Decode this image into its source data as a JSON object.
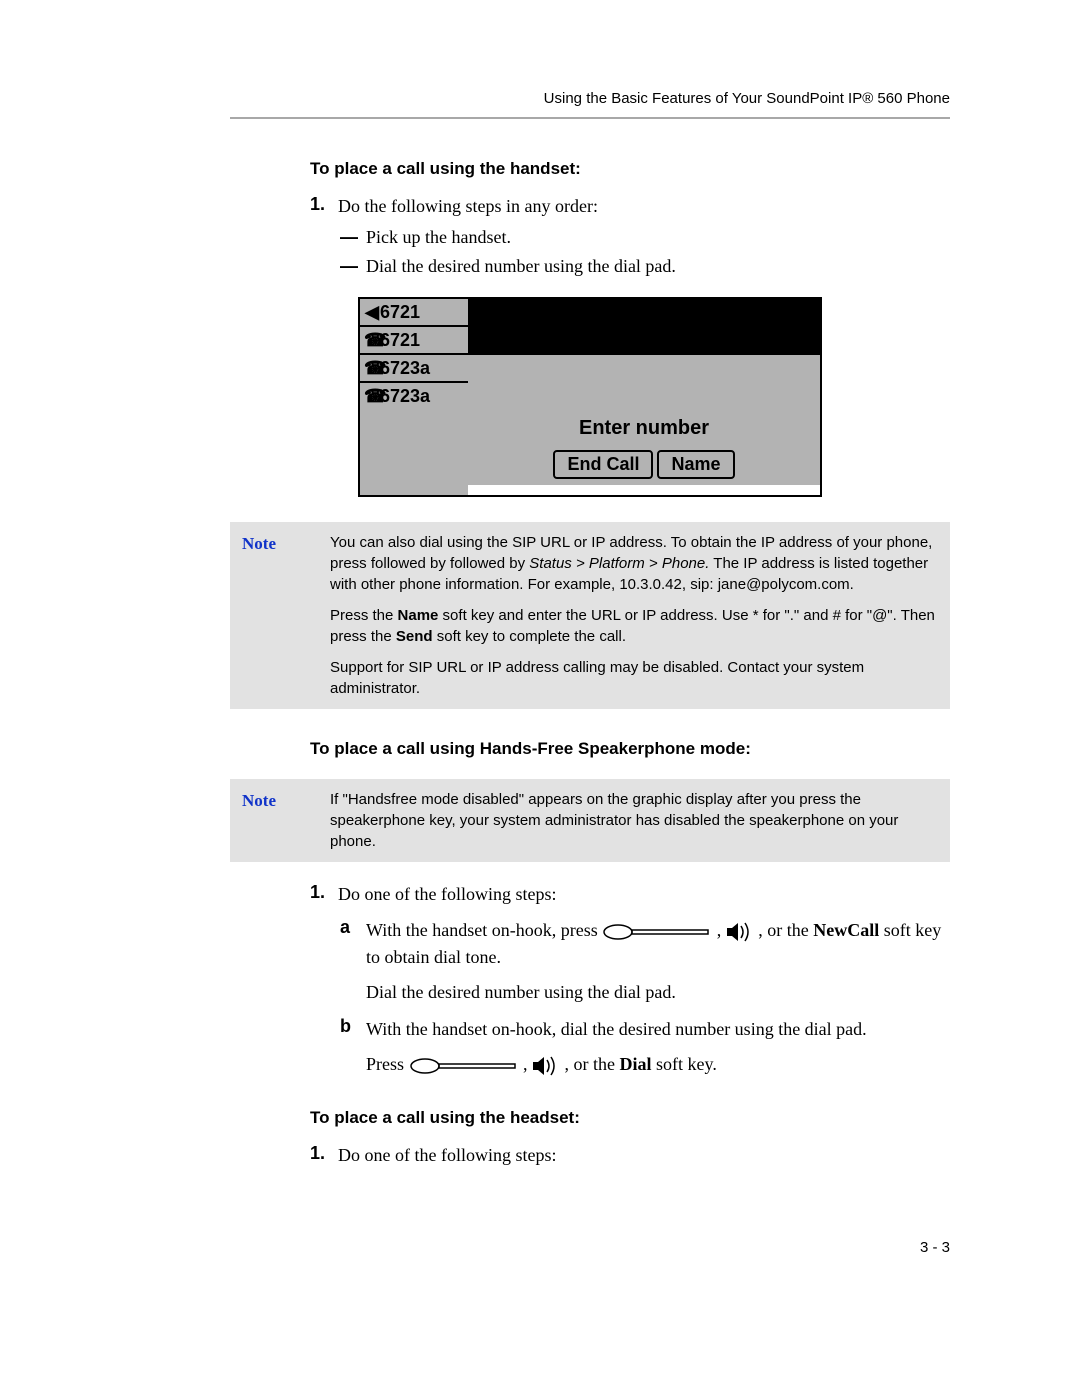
{
  "header": {
    "running_head": "Using the Basic Features of Your SoundPoint IP® 560 Phone"
  },
  "page_number": "3 - 3",
  "section1": {
    "heading": "To place a call using the handset:",
    "step1_num": "1.",
    "step1_text": "Do the following steps in any order:",
    "dash": "—",
    "bullet_a": "Pick up the handset.",
    "bullet_b": "Dial the desired number using the dial pad."
  },
  "lcd": {
    "line1": "6721",
    "line2": "6721",
    "line3": "6723a",
    "line4": "6723a",
    "prompt": "Enter number",
    "softkey1": "End Call",
    "softkey2": "Name"
  },
  "note1": {
    "label": "Note",
    "p1a": "You can also dial using the SIP URL or IP address. To obtain the IP address of your phone, press followed by followed by ",
    "p1b": "Status > Platform > Phone.",
    "p1c": " The IP address is listed together with other phone information. For example, 10.3.0.42, sip: jane@polycom.com.",
    "p2a": "Press the ",
    "p2b": "Name",
    "p2c": " soft key and enter the URL or IP address. Use * for \".\" and # for \"@\". Then press the ",
    "p2d": "Send",
    "p2e": " soft key to complete the call.",
    "p3": "Support for SIP URL or IP address calling may be disabled. Contact your system administrator."
  },
  "section2": {
    "heading": "To place a call using Hands-Free Speakerphone mode:"
  },
  "note2": {
    "label": "Note",
    "p1": "If \"Handsfree mode disabled\" appears on the graphic display after you press the speakerphone key, your system administrator has disabled the speakerphone on your phone."
  },
  "steps2": {
    "step1_num": "1.",
    "step1_text": "Do one of the following steps:",
    "a_label": "a",
    "a_pre": "With the handset on-hook, press ",
    "a_post": ", or the ",
    "a_bold": "NewCall",
    "a_tail": " soft key to obtain dial tone.",
    "a_line2": "Dial the desired number using the dial pad.",
    "b_label": "b",
    "b_line1": "With the handset on-hook, dial the desired number using the dial pad.",
    "b_pre": "Press ",
    "b_mid": ", or the ",
    "b_bold": "Dial",
    "b_tail": " soft key.",
    "comma": " , "
  },
  "section3": {
    "heading": "To place a call using the headset:",
    "step1_num": "1.",
    "step1_text": "Do one of the following steps:"
  }
}
